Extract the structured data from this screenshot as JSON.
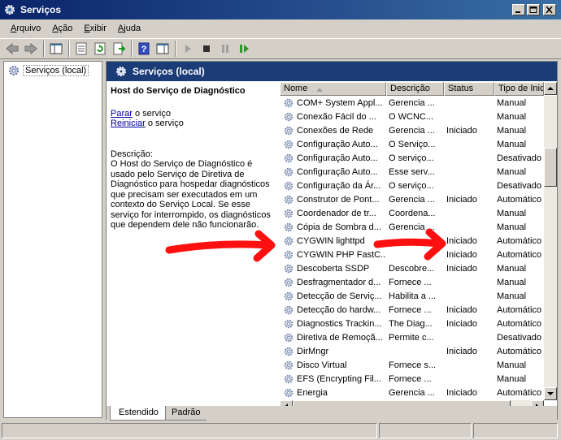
{
  "window": {
    "title": "Serviços"
  },
  "menu": [
    {
      "label": "Arquivo",
      "key": "A",
      "rest": "rquivo"
    },
    {
      "label": "Ação",
      "key": "A",
      "rest": "ção"
    },
    {
      "label": "Exibir",
      "key": "E",
      "rest": "xibir"
    },
    {
      "label": "Ajuda",
      "key": "A",
      "rest": "juda"
    }
  ],
  "tree": {
    "root": "Serviços (local)"
  },
  "pane": {
    "header": "Serviços (local)",
    "service_title": "Host do Serviço de Diagnóstico",
    "stop_link": "Parar",
    "stop_text": " o serviço",
    "restart_link": "Reiniciar",
    "restart_text": " o serviço",
    "description_label": "Descrição:",
    "description": "O Host do Serviço de Diagnóstico é usado pelo Serviço de Diretiva de Diagnóstico para hospedar diagnósticos que precisam ser executados em um contexto do Serviço Local. Se esse serviço for interrompido, os diagnósticos que dependem dele não funcionarão."
  },
  "columns": {
    "name": "Nome",
    "description": "Descrição",
    "status": "Status",
    "startup": "Tipo de Inicia"
  },
  "services": [
    {
      "name": "COM+ System Appl...",
      "desc": "Gerencia ...",
      "status": "",
      "type": "Manual"
    },
    {
      "name": "Conexão Fácil do ...",
      "desc": "O WCNC...",
      "status": "",
      "type": "Manual"
    },
    {
      "name": "Conexões de Rede",
      "desc": "Gerencia ...",
      "status": "Iniciado",
      "type": "Manual"
    },
    {
      "name": "Configuração Auto...",
      "desc": "O Serviço...",
      "status": "",
      "type": "Manual"
    },
    {
      "name": "Configuração Auto...",
      "desc": "O serviço...",
      "status": "",
      "type": "Desativado"
    },
    {
      "name": "Configuração Auto...",
      "desc": "Esse serv...",
      "status": "",
      "type": "Manual"
    },
    {
      "name": "Configuração da Ár...",
      "desc": "O serviço...",
      "status": "",
      "type": "Desativado"
    },
    {
      "name": "Construtor de Pont...",
      "desc": "Gerencia ...",
      "status": "Iniciado",
      "type": "Automático"
    },
    {
      "name": "Coordenador de tr...",
      "desc": "Coordena...",
      "status": "",
      "type": "Manual"
    },
    {
      "name": "Cópia de Sombra d...",
      "desc": "Gerencia ...",
      "status": "",
      "type": "Manual"
    },
    {
      "name": "CYGWIN lighttpd",
      "desc": "",
      "status": "Iniciado",
      "type": "Automático"
    },
    {
      "name": "CYGWIN PHP FastC...",
      "desc": "",
      "status": "Iniciado",
      "type": "Automático"
    },
    {
      "name": "Descoberta SSDP",
      "desc": "Descobre...",
      "status": "Iniciado",
      "type": "Manual"
    },
    {
      "name": "Desfragmentador d...",
      "desc": "Fornece ...",
      "status": "",
      "type": "Manual"
    },
    {
      "name": "Detecção de Serviç...",
      "desc": "Habilita a ...",
      "status": "",
      "type": "Manual"
    },
    {
      "name": "Detecção do hardw...",
      "desc": "Fornece ...",
      "status": "Iniciado",
      "type": "Automático"
    },
    {
      "name": "Diagnostics Trackin...",
      "desc": "The Diag...",
      "status": "Iniciado",
      "type": "Automático"
    },
    {
      "name": "Diretiva de Remoçã...",
      "desc": "Permite c...",
      "status": "",
      "type": "Desativado"
    },
    {
      "name": "DirMngr",
      "desc": "",
      "status": "Iniciado",
      "type": "Automático"
    },
    {
      "name": "Disco Virtual",
      "desc": "Fornece s...",
      "status": "",
      "type": "Manual"
    },
    {
      "name": "EFS (Encrypting Fil...",
      "desc": "Fornece ...",
      "status": "",
      "type": "Manual"
    },
    {
      "name": "Energia",
      "desc": "Gerencia ...",
      "status": "Iniciado",
      "type": "Automático"
    }
  ],
  "tabs": {
    "extended": "Estendido",
    "standard": "Padrão"
  },
  "colors": {
    "annotation_arrow": "#ff1010"
  }
}
